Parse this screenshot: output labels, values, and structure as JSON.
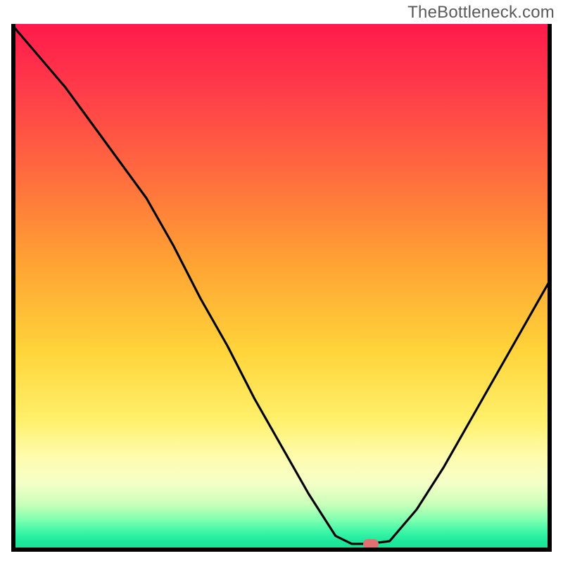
{
  "watermark": "TheBottleneck.com",
  "colors": {
    "gradient_top": "#ff1a4b",
    "gradient_mid": "#ffd43a",
    "gradient_bottom": "#18e094",
    "axis": "#000000",
    "curve": "#000000",
    "marker": "#e17171"
  },
  "chart_data": {
    "type": "line",
    "title": "",
    "xlabel": "",
    "ylabel": "",
    "xlim": [
      0,
      1
    ],
    "ylim": [
      0,
      1
    ],
    "grid": false,
    "legend": false,
    "background": "vertical-gradient red→yellow→green",
    "series": [
      {
        "name": "curve",
        "x": [
          0.0,
          0.05,
          0.1,
          0.15,
          0.2,
          0.25,
          0.3,
          0.35,
          0.4,
          0.45,
          0.5,
          0.55,
          0.6,
          0.63,
          0.66,
          0.7,
          0.75,
          0.8,
          0.85,
          0.9,
          0.95,
          1.0
        ],
        "y": [
          1.0,
          0.94,
          0.88,
          0.81,
          0.74,
          0.67,
          0.58,
          0.48,
          0.39,
          0.29,
          0.2,
          0.11,
          0.03,
          0.015,
          0.015,
          0.02,
          0.08,
          0.16,
          0.25,
          0.34,
          0.43,
          0.52
        ]
      }
    ],
    "marker": {
      "x": 0.665,
      "y": 0.015
    }
  }
}
